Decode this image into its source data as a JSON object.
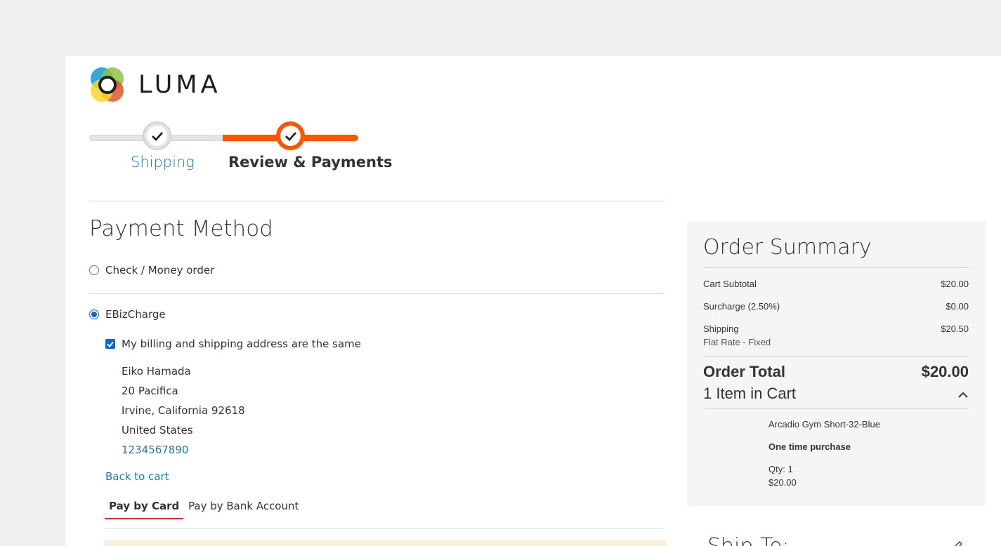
{
  "brand": {
    "name": "LUMA"
  },
  "progress": {
    "steps": [
      {
        "label": "Shipping",
        "state": "completed"
      },
      {
        "label": "Review & Payments",
        "state": "active"
      }
    ]
  },
  "payment": {
    "title": "Payment Method",
    "methods": [
      {
        "label": "Check / Money order",
        "selected": false
      },
      {
        "label": "EBizCharge",
        "selected": true
      }
    ],
    "billing_same_label": "My billing and shipping address are the same",
    "address": {
      "name": "Eiko Hamada",
      "street": "20 Pacifica",
      "city_line": "Irvine, California 92618",
      "country": "United States",
      "phone": "1234567890"
    },
    "back_link": "Back to cart",
    "tabs": [
      {
        "label": "Pay by Card",
        "active": true
      },
      {
        "label": "Pay by Bank Account",
        "active": false
      }
    ]
  },
  "summary": {
    "title": "Order Summary",
    "cart_subtotal_label": "Cart Subtotal",
    "cart_subtotal_value": "$20.00",
    "surcharge_label": "Surcharge (2.50%)",
    "surcharge_value": "$0.00",
    "shipping_label": "Shipping",
    "shipping_value": "$20.50",
    "shipping_method": "Flat Rate - Fixed",
    "order_total_label": "Order Total",
    "order_total_value": "$20.00",
    "items_label": "1 Item in Cart",
    "item": {
      "name": "Arcadio Gym Short-32-Blue",
      "purchase_type": "One time purchase",
      "qty": "Qty: 1",
      "price": "$20.00"
    }
  },
  "ship_to": {
    "title": "Ship To:"
  },
  "colors": {
    "accent": "#ff5501",
    "link": "#1979c3",
    "tab_underline": "#e02b27"
  }
}
